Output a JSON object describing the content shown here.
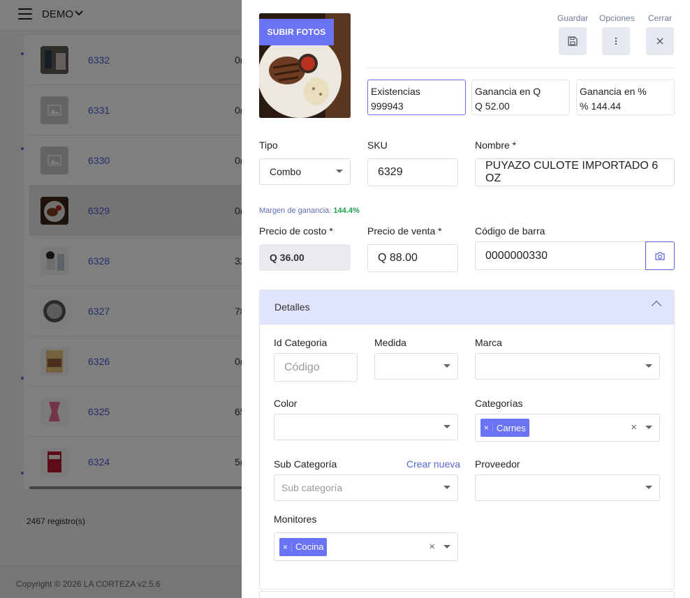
{
  "app": {
    "brand": "DEMO"
  },
  "list": {
    "rows": [
      {
        "id": "6332",
        "value": "0("
      },
      {
        "id": "6331",
        "value": "0("
      },
      {
        "id": "6330",
        "value": "0("
      },
      {
        "id": "6329",
        "value": "0("
      },
      {
        "id": "6328",
        "value": "32"
      },
      {
        "id": "6327",
        "value": "78"
      },
      {
        "id": "6326",
        "value": "0("
      },
      {
        "id": "6325",
        "value": "65"
      },
      {
        "id": "6324",
        "value": "5("
      }
    ],
    "count": "2467 registro(s)"
  },
  "footer": {
    "text": "Copyright © 2026 LA CORTEZA v2.5.6"
  },
  "drawer": {
    "upload_label": "SUBIR FOTOS",
    "actions": {
      "save": "Guardar",
      "options": "Opciones",
      "close": "Cerrar"
    },
    "stats": {
      "stock_label": "Existencias",
      "stock_value": "999943",
      "profit_q_label": "Ganancia en Q",
      "profit_q_value": "Q 52.00",
      "profit_pct_label": "Ganancia en %",
      "profit_pct_value": "% 144.44"
    },
    "type_label": "Tipo",
    "type_value": "Combo",
    "sku_label": "SKU",
    "sku_value": "6329",
    "name_label": "Nombre *",
    "name_value": "PUYAZO CULOTE IMPORTADO 6 OZ",
    "margin_label": "Margen de ganancia:",
    "margin_value": "144.4%",
    "cost_label": "Precio de costo *",
    "cost_value": "Q 36.00",
    "price_label": "Precio de venta *",
    "price_value": "Q  88.00",
    "barcode_label": "Código de barra",
    "barcode_value": "0000000330",
    "details": {
      "title": "Detalles",
      "category_id_label": "Id Categoria",
      "category_id_placeholder": "Código",
      "unit_label": "Medida",
      "brand_label": "Marca",
      "color_label": "Color",
      "categories_label": "Categorías",
      "categories_tag": "Carnes",
      "subcategory_label": "Sub Categoría",
      "create_new": "Crear nueva",
      "subcategory_placeholder": "Sub categoría",
      "supplier_label": "Proveedor",
      "monitors_label": "Monitores",
      "monitors_tag": "Cocina"
    }
  },
  "colors": {
    "accent": "#6b73f5",
    "link": "#4a5ad8",
    "margin_ok": "#1aa34a"
  }
}
